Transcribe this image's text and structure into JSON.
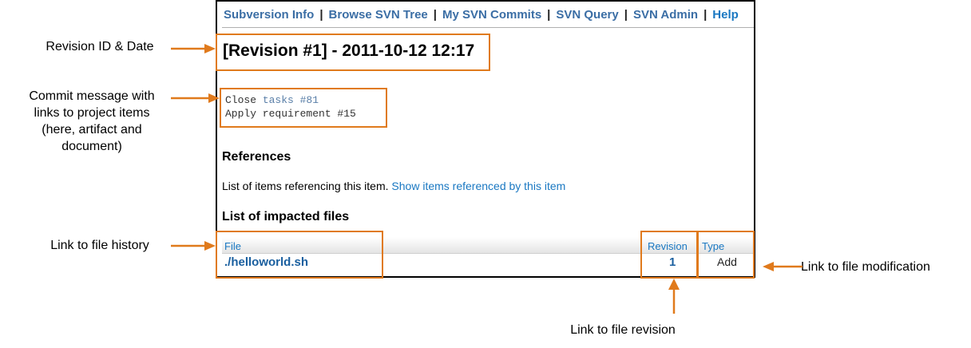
{
  "nav": {
    "items": [
      "Subversion Info",
      "Browse SVN Tree",
      "My SVN Commits",
      "SVN Query",
      "SVN Admin"
    ],
    "help": "Help",
    "separator": "|"
  },
  "revision": {
    "title": "[Revision #1] - 2011-10-12 12:17"
  },
  "commit_message": {
    "line1_prefix": "Close ",
    "line1_link": "tasks #81",
    "line2": "Apply requirement #15"
  },
  "references": {
    "heading": "References",
    "text": "List of items referencing this item.",
    "link": "Show items referenced by this item"
  },
  "files": {
    "heading": "List of impacted files",
    "columns": {
      "file": "File",
      "revision": "Revision",
      "type": "Type"
    },
    "rows": [
      {
        "file": "./helloworld.sh",
        "revision": "1",
        "type": "Add"
      }
    ]
  },
  "callouts": {
    "revision_id": "Revision ID & Date",
    "commit_message": [
      "Commit message with",
      "links to project items",
      "(here, artifact and",
      "document)"
    ],
    "file_history": "Link to file history",
    "file_modification": "Link to file modification",
    "file_revision": "Link to file revision"
  },
  "colors": {
    "highlight": "#e07a1c",
    "link": "#1a78c2",
    "nav_link": "#3b6ea5"
  }
}
